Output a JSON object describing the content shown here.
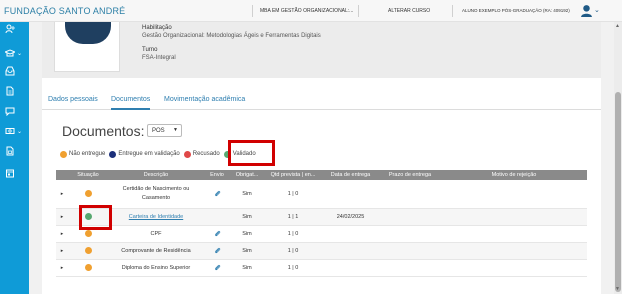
{
  "topbar": {
    "brand": "FUNDAÇÃO SANTO ANDRÉ",
    "course": "MBA EM GESTÃO ORGANIZACIONAL:...",
    "change_course": "ALTERAR CURSO",
    "user": "ALUNO EXEMPLO PÓS-GRADUAÇÃO (RA: 409192)"
  },
  "sidebar": {
    "icons": [
      "user-plus-icon",
      "graduation-cap-icon",
      "inbox-icon",
      "document-icon",
      "chat-icon",
      "money-icon",
      "file-icon",
      "calendar-icon"
    ]
  },
  "profile": {
    "habilitacao_label": "Habilitação",
    "habilitacao_value": "Gestão Organizacional: Metodologias Ágeis e Ferramentas Digitais",
    "turno_label": "Turno",
    "turno_value": "FSA-Integral"
  },
  "tabs": [
    {
      "label": "Dados pessoais",
      "active": false
    },
    {
      "label": "Documentos",
      "active": true
    },
    {
      "label": "Movimentação acadêmica",
      "active": false
    }
  ],
  "documents": {
    "title": "Documentos:",
    "filter_value": "POS",
    "legend": [
      {
        "label": "Não entregue",
        "color": "#f0a030"
      },
      {
        "label": "Entregue em validação",
        "color": "#1c2f7a"
      },
      {
        "label": "Recusado",
        "color": "#e04848"
      },
      {
        "label": "Validado",
        "color": "#57a870"
      }
    ],
    "columns": [
      "Situação",
      "Descrição",
      "Envio",
      "Obrigat...",
      "Qtd prevista | en...",
      "Data de entrega",
      "Prazo de entrega",
      "Motivo de rejeição"
    ],
    "rows": [
      {
        "status": "orange",
        "description": "Certidão de Nascimento ou Casamento",
        "description_line1": "Certidão de Nascimento ou",
        "description_line2": "Casamento",
        "link": false,
        "has_clip": true,
        "required": "Sim",
        "qty": "1 | 0",
        "delivery_date": "",
        "deadline": "",
        "rejection": ""
      },
      {
        "status": "green",
        "description": "Carteira de Identidade",
        "link": true,
        "has_clip": false,
        "required": "Sim",
        "qty": "1 | 1",
        "delivery_date": "24/02/2025",
        "deadline": "",
        "rejection": ""
      },
      {
        "status": "orange",
        "description": "CPF",
        "link": false,
        "has_clip": true,
        "required": "Sim",
        "qty": "1 | 0",
        "delivery_date": "",
        "deadline": "",
        "rejection": ""
      },
      {
        "status": "orange",
        "description": "Comprovante de Residência",
        "link": false,
        "has_clip": true,
        "required": "Sim",
        "qty": "1 | 0",
        "delivery_date": "",
        "deadline": "",
        "rejection": ""
      },
      {
        "status": "orange",
        "description": "Diploma do Ensino Superior",
        "link": false,
        "has_clip": true,
        "required": "Sim",
        "qty": "1 | 0",
        "delivery_date": "",
        "deadline": "",
        "rejection": ""
      }
    ]
  },
  "colors": {
    "brand": "#2c7fa6",
    "sidebar": "#0f9bd7",
    "highlight": "#d10000",
    "not_delivered": "#f0a030",
    "validated": "#57a870"
  }
}
